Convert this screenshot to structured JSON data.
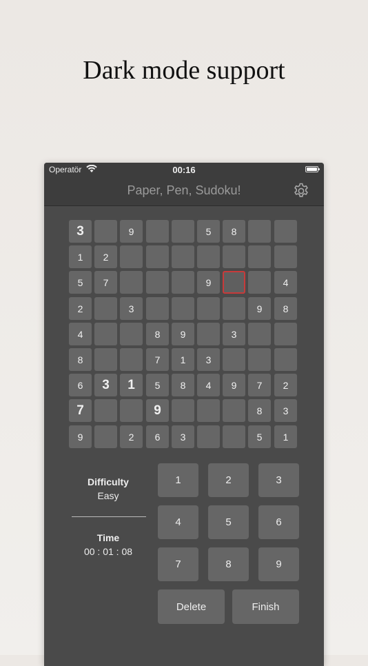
{
  "headline": "Dark mode support",
  "status_bar": {
    "carrier": "Operatör",
    "time": "00:16"
  },
  "nav": {
    "title": "Paper, Pen, Sudoku!",
    "settings_icon": "gear-icon"
  },
  "board": {
    "rows": [
      [
        "3",
        "",
        "9",
        "",
        "",
        "5",
        "8",
        "",
        ""
      ],
      [
        "1",
        "2",
        "",
        "",
        "",
        "",
        "",
        "",
        ""
      ],
      [
        "5",
        "7",
        "",
        "",
        "",
        "9",
        "",
        "",
        "4"
      ],
      [
        "2",
        "",
        "3",
        "",
        "",
        "",
        "",
        "9",
        "8"
      ],
      [
        "4",
        "",
        "",
        "8",
        "9",
        "",
        "3",
        "",
        ""
      ],
      [
        "8",
        "",
        "",
        "7",
        "1",
        "3",
        "",
        "",
        ""
      ],
      [
        "6",
        "3",
        "1",
        "5",
        "8",
        "4",
        "9",
        "7",
        "2"
      ],
      [
        "7",
        "",
        "",
        "9",
        "",
        "",
        "",
        "8",
        "3"
      ],
      [
        "9",
        "",
        "2",
        "6",
        "3",
        "",
        "",
        "5",
        "1"
      ]
    ],
    "given": [
      [
        0,
        0
      ],
      [
        6,
        1
      ],
      [
        6,
        2
      ],
      [
        7,
        0
      ],
      [
        7,
        3
      ]
    ],
    "selected": [
      2,
      6
    ],
    "selected_color": "#c83a3a"
  },
  "info": {
    "difficulty_label": "Difficulty",
    "difficulty_value": "Easy",
    "time_label": "Time",
    "time_value": "00 : 01 : 08"
  },
  "keypad": {
    "numbers": [
      "1",
      "2",
      "3",
      "4",
      "5",
      "6",
      "7",
      "8",
      "9"
    ],
    "delete_label": "Delete",
    "finish_label": "Finish"
  }
}
